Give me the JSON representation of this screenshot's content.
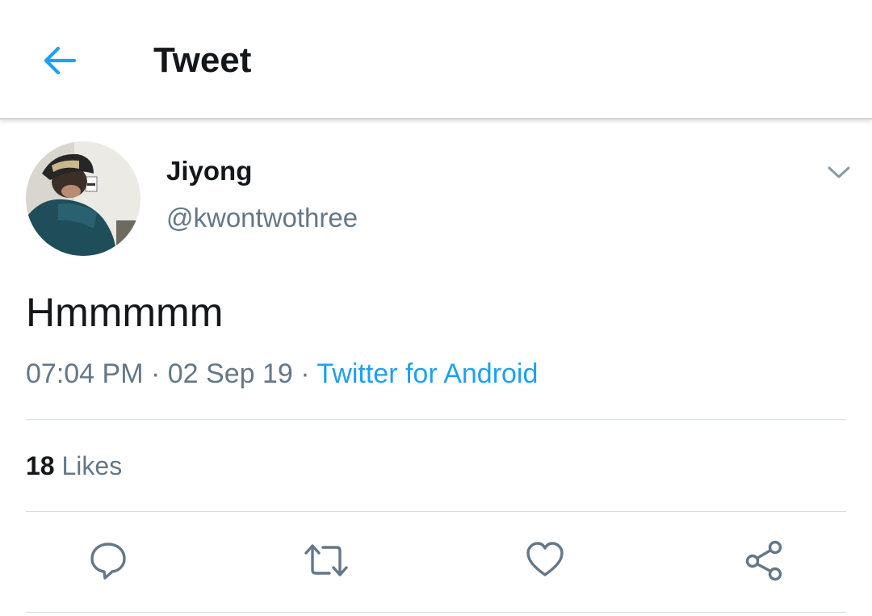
{
  "header": {
    "title": "Tweet",
    "back_icon": "arrow-left-icon",
    "accent_color": "#1da1f2"
  },
  "tweet": {
    "author": {
      "display_name": "Jiyong",
      "handle": "@kwontwothree",
      "avatar_icon": "profile-photo"
    },
    "text": "Hmmmmm",
    "time": "07:04 PM",
    "date": "02 Sep 19",
    "separator": " · ",
    "source": "Twitter for Android",
    "likes_count": "18",
    "likes_label": "Likes"
  },
  "actions": [
    {
      "name": "reply",
      "icon": "speech-bubble-icon"
    },
    {
      "name": "retweet",
      "icon": "retweet-icon"
    },
    {
      "name": "like",
      "icon": "heart-icon"
    },
    {
      "name": "share",
      "icon": "share-icon"
    }
  ],
  "colors": {
    "text_primary": "#14171a",
    "text_secondary": "#657786",
    "link": "#1da1f2",
    "divider": "#d8dde1"
  }
}
